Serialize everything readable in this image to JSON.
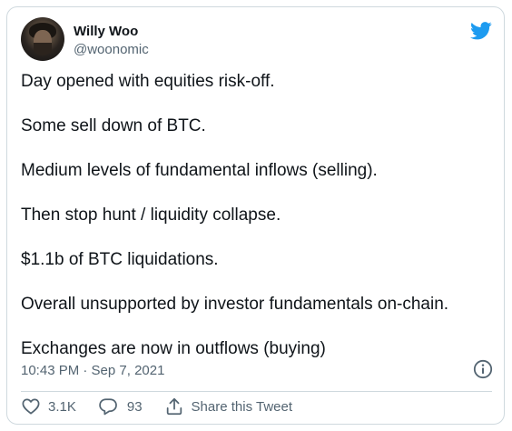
{
  "author": {
    "name": "Willy Woo",
    "handle": "@woonomic"
  },
  "tweet": {
    "lines": [
      "Day opened with equities risk-off.",
      "Some sell down of BTC.",
      "Medium levels of fundamental inflows (selling).",
      "Then stop hunt / liquidity collapse.",
      "$1.1b of BTC liquidations.",
      "Overall unsupported by investor fundamentals on-chain.",
      "Exchanges are now in outflows (buying)"
    ],
    "timestamp": "10:43 PM · Sep 7, 2021"
  },
  "actions": {
    "likes": "3.1K",
    "replies": "93",
    "share_label": "Share this Tweet"
  },
  "icons": {
    "brand": "twitter-bird-icon",
    "info": "info-icon",
    "like": "heart-icon",
    "reply": "reply-bubble-icon",
    "share": "share-icon"
  },
  "colors": {
    "brand": "#1d9bf0",
    "text": "#0f1419",
    "secondary": "#536471",
    "border": "#cfd9de"
  }
}
